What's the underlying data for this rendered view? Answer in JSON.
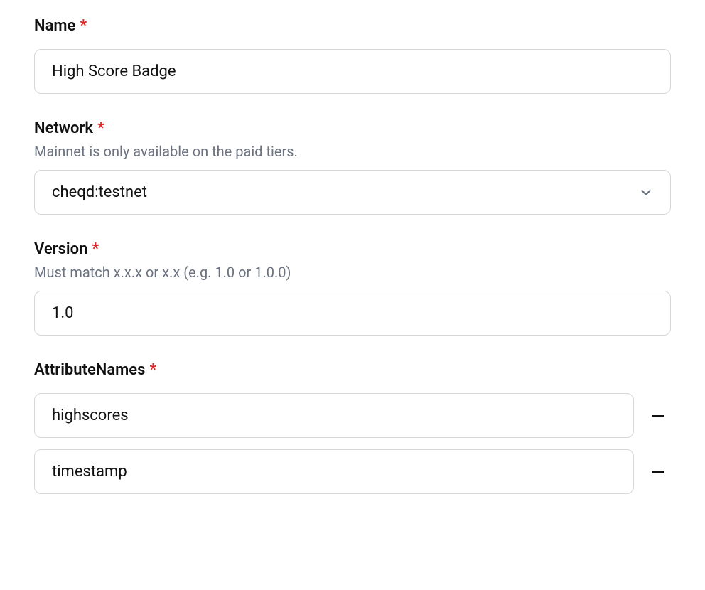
{
  "name": {
    "label": "Name",
    "value": "High Score Badge"
  },
  "network": {
    "label": "Network",
    "description": "Mainnet is only available on the paid tiers.",
    "value": "cheqd:testnet"
  },
  "version": {
    "label": "Version",
    "description": "Must match x.x.x or x.x (e.g. 1.0 or 1.0.0)",
    "value": "1.0"
  },
  "attributeNames": {
    "label": "AttributeNames",
    "items": [
      "highscores",
      "timestamp"
    ]
  },
  "required_marker": "*"
}
